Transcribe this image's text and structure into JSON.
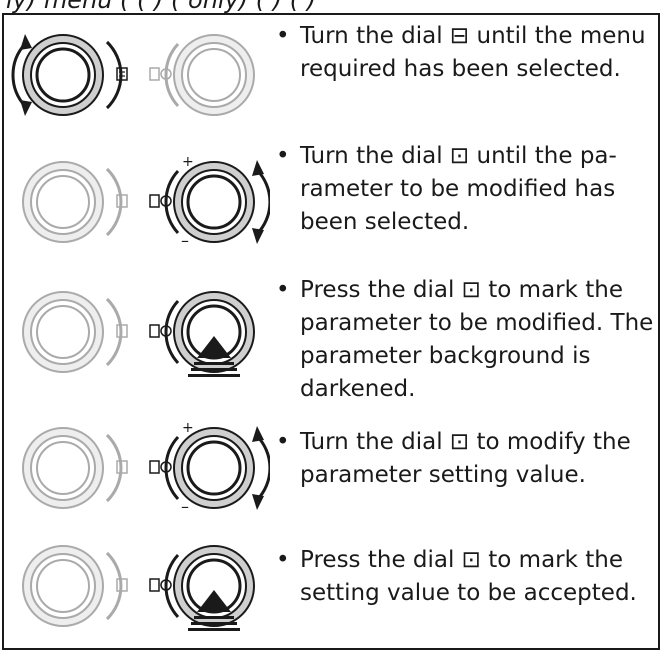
{
  "top_partial_text": "ly) menu ( ( ) ( only) ( ) ( )",
  "icons": {
    "left_dial_symbol": "menu-lines-icon",
    "right_dial_symbol": "parameter-select-icon"
  },
  "steps": [
    {
      "text": "Turn the dial ⊟ until the menu required has been selected.",
      "left_dial": "turn-active",
      "right_dial": "inactive"
    },
    {
      "text": "Turn the dial ⊡ until the pa-rameter to be modified has been selected.",
      "left_dial": "inactive",
      "right_dial": "turn-active"
    },
    {
      "text": "Press the dial ⊡ to mark the parameter to be modified. The parameter background is darkened.",
      "left_dial": "inactive",
      "right_dial": "press-active"
    },
    {
      "text": "Turn the dial ⊡ to modify the parameter setting value.",
      "left_dial": "inactive",
      "right_dial": "turn-active"
    },
    {
      "text": "Press the dial ⊡ to mark the setting value to be accepted.",
      "left_dial": "inactive",
      "right_dial": "press-active"
    }
  ],
  "bullet": "•",
  "plus": "+",
  "minus": "–"
}
